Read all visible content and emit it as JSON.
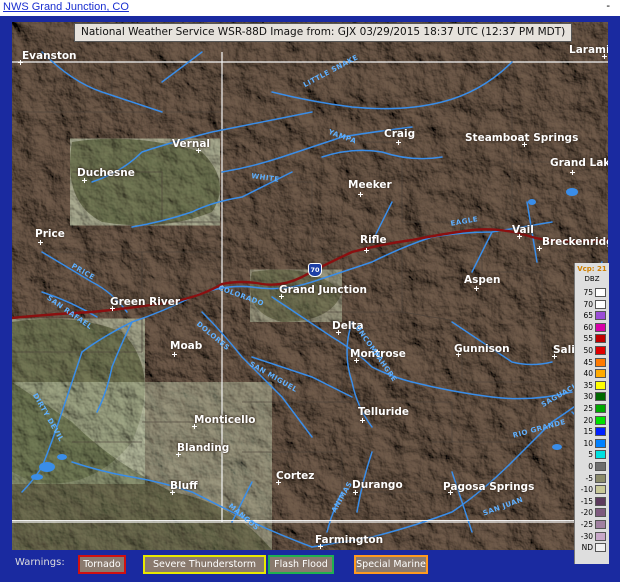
{
  "header": {
    "site_link": "NWS Grand Junction, CO",
    "dash": "-"
  },
  "map": {
    "title": "National Weather Service WSR-88D Image from: GJX 03/29/2015 18:37 UTC (12:37 PM MDT)",
    "interstate": "70",
    "cities": [
      {
        "name": "Evanston"
      },
      {
        "name": "Laramie"
      },
      {
        "name": "Vernal"
      },
      {
        "name": "Craig"
      },
      {
        "name": "Steamboat Springs"
      },
      {
        "name": "Duchesne"
      },
      {
        "name": "Grand Lake"
      },
      {
        "name": "Meeker"
      },
      {
        "name": "Price"
      },
      {
        "name": "Rifle"
      },
      {
        "name": "Vail"
      },
      {
        "name": "Breckenridge"
      },
      {
        "name": "Aspen"
      },
      {
        "name": "Grand Junction"
      },
      {
        "name": "Green River"
      },
      {
        "name": "Delta"
      },
      {
        "name": "Moab"
      },
      {
        "name": "Montrose"
      },
      {
        "name": "Gunnison"
      },
      {
        "name": "Sali"
      },
      {
        "name": "Monticello"
      },
      {
        "name": "Telluride"
      },
      {
        "name": "Blanding"
      },
      {
        "name": "Cortez"
      },
      {
        "name": "Bluff"
      },
      {
        "name": "Durango"
      },
      {
        "name": "Pagosa Springs"
      },
      {
        "name": "Farmington"
      }
    ],
    "rivers": [
      {
        "name": "LITTLE SNAKE"
      },
      {
        "name": "YAMPA"
      },
      {
        "name": "WHITE"
      },
      {
        "name": "EAGLE"
      },
      {
        "name": "COLORADO"
      },
      {
        "name": "PRICE"
      },
      {
        "name": "SAN RAFAEL"
      },
      {
        "name": "DOLORES"
      },
      {
        "name": "SAN MIGUEL"
      },
      {
        "name": "UNCOMPAHGRE"
      },
      {
        "name": "DIRTY DEVIL"
      },
      {
        "name": "SAGUACHE"
      },
      {
        "name": "RIO GRANDE"
      },
      {
        "name": "SAN JUAN"
      },
      {
        "name": "MANCOS"
      },
      {
        "name": "ANIMAS"
      }
    ]
  },
  "legend": {
    "title": "Vcp: 21",
    "unit": "DBZ",
    "rows": [
      {
        "label": "75",
        "color": "#ffffff"
      },
      {
        "label": "70",
        "color": "#ffffff"
      },
      {
        "label": "65",
        "color": "#9b4dd6"
      },
      {
        "label": "60",
        "color": "#d800a8"
      },
      {
        "label": "55",
        "color": "#c00000"
      },
      {
        "label": "50",
        "color": "#e00000"
      },
      {
        "label": "45",
        "color": "#ff7a00"
      },
      {
        "label": "40",
        "color": "#ffaa00"
      },
      {
        "label": "35",
        "color": "#ffff00"
      },
      {
        "label": "30",
        "color": "#006800"
      },
      {
        "label": "25",
        "color": "#00a800"
      },
      {
        "label": "20",
        "color": "#00e000"
      },
      {
        "label": "15",
        "color": "#0020ff"
      },
      {
        "label": "10",
        "color": "#0080ff"
      },
      {
        "label": "5",
        "color": "#00e0e0"
      },
      {
        "label": "0",
        "color": "#6e6e6e"
      },
      {
        "label": "-5",
        "color": "#8a8a6a"
      },
      {
        "label": "-10",
        "color": "#c8c898"
      },
      {
        "label": "-15",
        "color": "#5c3a5c"
      },
      {
        "label": "-20",
        "color": "#7e5a7e"
      },
      {
        "label": "-25",
        "color": "#a080a0"
      },
      {
        "label": "-30",
        "color": "#c8a8c8"
      },
      {
        "label": "ND",
        "color": "#f0f0f0"
      }
    ]
  },
  "warnings": {
    "label": "Warnings:",
    "items": [
      {
        "label": "Tornado",
        "color": "#d01010"
      },
      {
        "label": "Severe Thunderstorm",
        "color": "#e8e800"
      },
      {
        "label": "Flash Flood",
        "color": "#20b050"
      },
      {
        "label": "Special Marine",
        "color": "#ff9a20"
      }
    ]
  }
}
